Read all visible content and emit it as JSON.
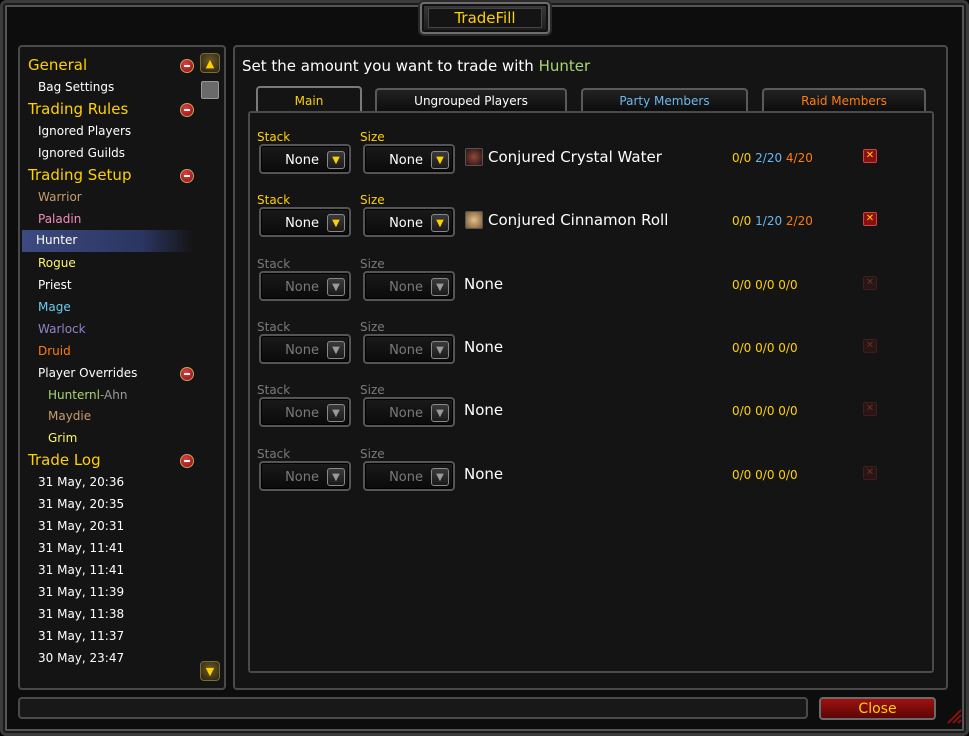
{
  "window": {
    "title": "TradeFill"
  },
  "nav": {
    "general": "General",
    "bag_settings": "Bag Settings",
    "trading_rules": "Trading Rules",
    "ignored_players": "Ignored Players",
    "ignored_guilds": "Ignored Guilds",
    "trading_setup": "Trading Setup",
    "classes": [
      {
        "label": "Warrior",
        "color": "#c79c6e"
      },
      {
        "label": "Paladin",
        "color": "#f58cba"
      },
      {
        "label": "Hunter",
        "color": "#ffffff"
      },
      {
        "label": "Rogue",
        "color": "#fff569"
      },
      {
        "label": "Priest",
        "color": "#ffffff"
      },
      {
        "label": "Mage",
        "color": "#69ccf0"
      },
      {
        "label": "Warlock",
        "color": "#9482c9"
      },
      {
        "label": "Druid",
        "color": "#ff7d0a"
      }
    ],
    "player_overrides": "Player Overrides",
    "overrides": {
      "p1_name": "Hunternl",
      "p1_realm": "-Ahn",
      "p2": "Maydie",
      "p3": "Grim"
    },
    "trade_log": "Trade Log",
    "log_entries": [
      "31 May, 20:36",
      "31 May, 20:35",
      "31 May, 20:31",
      "31 May, 11:41",
      "31 May, 11:41",
      "31 May, 11:39",
      "31 May, 11:38",
      "31 May, 11:37",
      "30 May, 23:47"
    ]
  },
  "main": {
    "prompt_prefix": "Set the amount you want to trade with",
    "prompt_target": "Hunter",
    "tabs": [
      {
        "label": "Main",
        "color": "#ffd100"
      },
      {
        "label": "Ungrouped Players",
        "color": "#ffffff"
      },
      {
        "label": "Party Members",
        "color": "#69b8f0"
      },
      {
        "label": "Raid Members",
        "color": "#ff7d0a"
      }
    ],
    "stack_label": "Stack",
    "size_label": "Size",
    "rows": [
      {
        "stack": "None",
        "size": "None",
        "item": "Conjured Crystal Water",
        "c1": "0/0",
        "c2": "2/20",
        "c3": "4/20",
        "active": true
      },
      {
        "stack": "None",
        "size": "None",
        "item": "Conjured Cinnamon Roll",
        "c1": "0/0",
        "c2": "1/20",
        "c3": "2/20",
        "active": true
      },
      {
        "stack": "None",
        "size": "None",
        "item": "None",
        "c1": "0/0",
        "c2": "0/0",
        "c3": "0/0",
        "active": false
      },
      {
        "stack": "None",
        "size": "None",
        "item": "None",
        "c1": "0/0",
        "c2": "0/0",
        "c3": "0/0",
        "active": false
      },
      {
        "stack": "None",
        "size": "None",
        "item": "None",
        "c1": "0/0",
        "c2": "0/0",
        "c3": "0/0",
        "active": false
      },
      {
        "stack": "None",
        "size": "None",
        "item": "None",
        "c1": "0/0",
        "c2": "0/0",
        "c3": "0/0",
        "active": false
      }
    ]
  },
  "footer": {
    "close_label": "Close",
    "status_text": ""
  }
}
